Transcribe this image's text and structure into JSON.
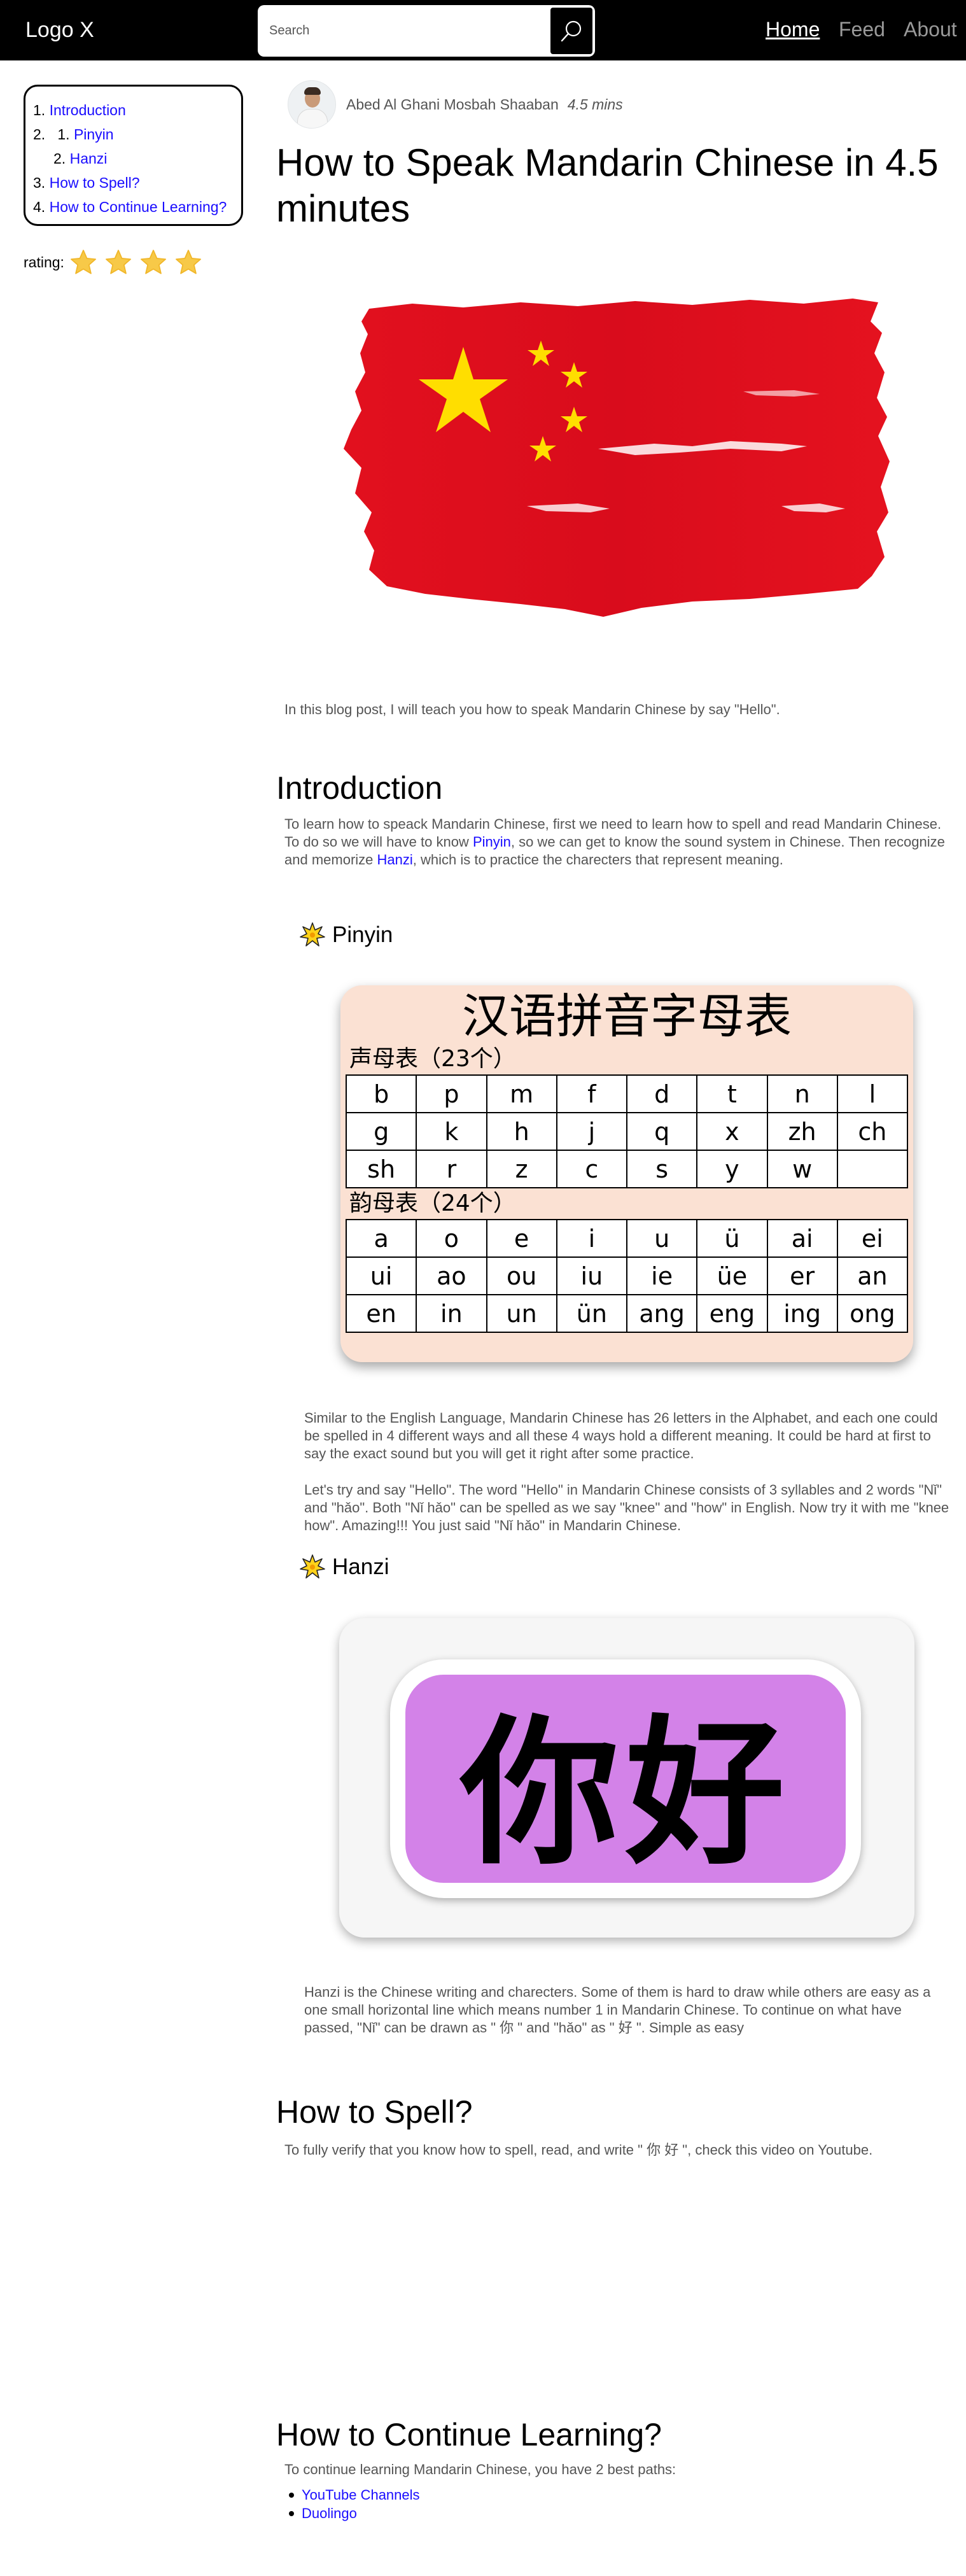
{
  "header": {
    "logo": "Logo X",
    "search_placeholder": "Search",
    "nav": [
      "Home",
      "Feed",
      "About"
    ]
  },
  "toc": [
    {
      "num": "1.",
      "label": "Introduction"
    },
    {
      "num": "2.",
      "label": "Pinyin",
      "sub": "1."
    },
    {
      "num": "2.",
      "label": "Hanzi"
    },
    {
      "num": "3.",
      "label": "How to Spell?"
    },
    {
      "num": "4.",
      "label": "How to Continue Learning?"
    }
  ],
  "rating": {
    "label": "rating:",
    "stars": 4,
    "max": 4
  },
  "article": {
    "author": "Abed Al Ghani Mosbah Shaaban",
    "read_time": "4.5 mins",
    "title": "How to Speak Mandarin Chinese in 4.5 minutes",
    "intro_line": "In this blog post, I will teach you how to speak Mandarin Chinese by say \"Hello\".",
    "introduction": {
      "heading": "Introduction",
      "text_1": "To learn how to speack Mandarin Chinese, first we need to learn how to spell and read Mandarin Chinese. To do so we will have to know ",
      "link_pinyin": "Pinyin",
      "text_2": ", so we can get to know the sound system in Chinese. Then recognize and memorize ",
      "link_hanzi": "Hanzi",
      "text_3": ", which is to practice the charecters that represent meaning."
    },
    "pinyin": {
      "heading": "Pinyin",
      "card_title": "汉语拼音字母表",
      "initials_label": "声母表（23个）",
      "initials": [
        [
          "b",
          "p",
          "m",
          "f",
          "d",
          "t",
          "n",
          "l"
        ],
        [
          "g",
          "k",
          "h",
          "j",
          "q",
          "x",
          "zh",
          "ch"
        ],
        [
          "sh",
          "r",
          "z",
          "c",
          "s",
          "y",
          "w",
          ""
        ]
      ],
      "finals_label": "韵母表（24个）",
      "finals": [
        [
          "a",
          "o",
          "e",
          "i",
          "u",
          "ü",
          "ai",
          "ei"
        ],
        [
          "ui",
          "ao",
          "ou",
          "iu",
          "ie",
          "üe",
          "er",
          "an"
        ],
        [
          "en",
          "in",
          "un",
          "ün",
          "ang",
          "eng",
          "ing",
          "ong"
        ]
      ],
      "para_1": "Similar to the English Language, Mandarin Chinese has 26 letters in the Alphabet, and each one could be spelled in 4 different ways and all these 4 ways hold a different meaning. It could be hard at first to say the exact sound but you will get it right after some practice.",
      "para_2": "Let's try and say \"Hello\". The word \"Hello\" in Mandarin Chinese consists of 3 syllables and 2 words \"Nǐ\" and \"hǎo\". Both \"Nǐ hǎo\" can be spelled as we say \"knee\" and \"how\" in English. Now try it with me \"knee how\". Amazing!!! You just said \"Nǐ hǎo\" in Mandarin Chinese."
    },
    "hanzi": {
      "heading": "Hanzi",
      "card_text": "你好",
      "para": "Hanzi is the Chinese writing and charecters. Some of them is hard to draw while others are easy as a one small horizontal line which means number 1 in Mandarin Chinese. To continue on what have passed, \"Nǐ\" can be drawn as \" 你 \" and \"hǎo\" as \" 好 \". Simple as easy"
    },
    "spell": {
      "heading": "How to Spell?",
      "para": "To fully verify that you know how to spell, read, and write \" 你 好 \", check this video on Youtube."
    },
    "continue": {
      "heading": "How to Continue Learning?",
      "para": "To continue learning Mandarin Chinese, you have 2 best paths:",
      "links": [
        "YouTube Channels",
        "Duolingo"
      ]
    }
  },
  "colors": {
    "topbar": "#000000",
    "link": "#1a0dff",
    "flag_red": "#e0101f",
    "flag_star": "#ffde00",
    "star": "#f7c948",
    "pinyin_bg": "#fbe1d3",
    "nihao_purple": "#d382e8"
  }
}
